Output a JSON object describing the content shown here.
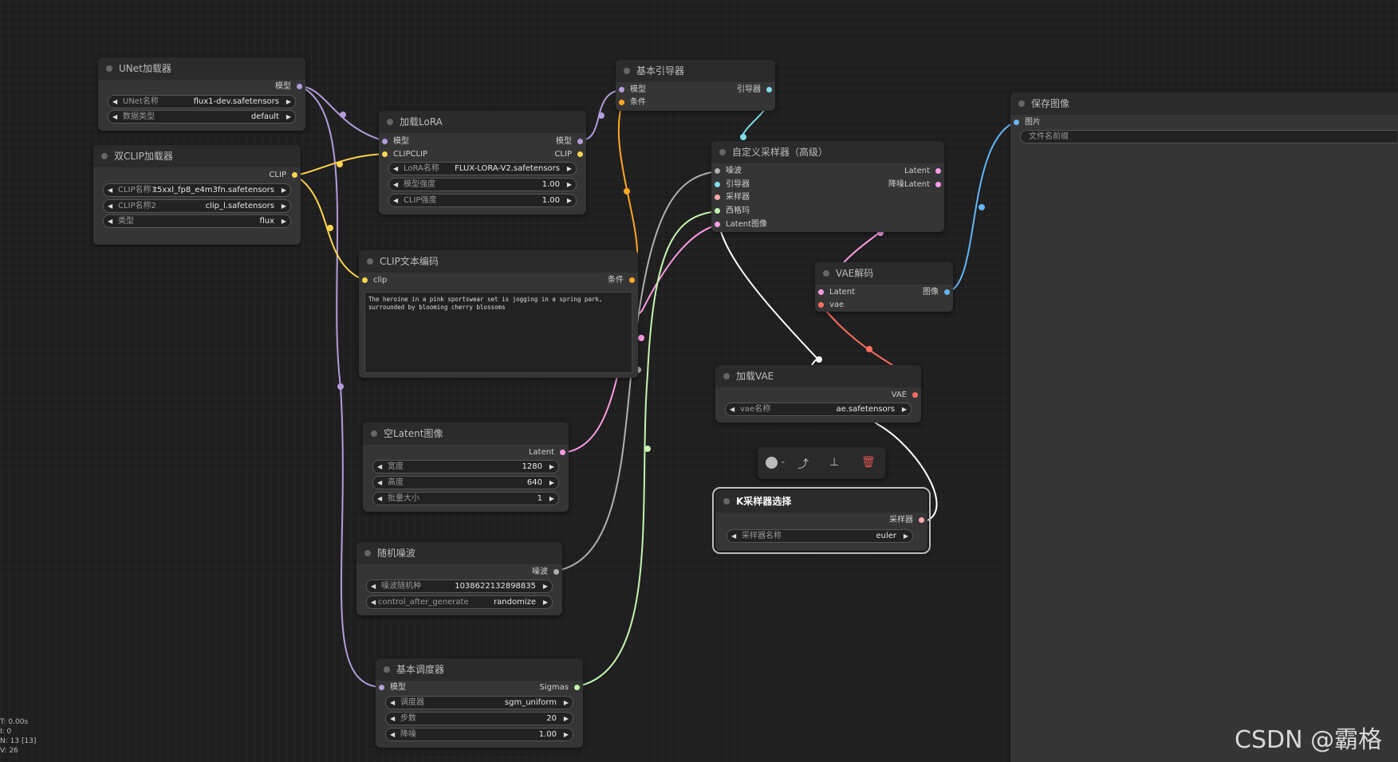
{
  "nodes": {
    "unet": {
      "title": "UNet加载器",
      "out_model": "模型",
      "w1": {
        "label": "UNet名称",
        "value": "flux1-dev.safetensors"
      },
      "w2": {
        "label": "数据类型",
        "value": "default"
      }
    },
    "dualclip": {
      "title": "双CLIP加载器",
      "out_clip": "CLIP",
      "w1": {
        "label": "CLIP名称1",
        "value": "t5xxl_fp8_e4m3fn.safetensors"
      },
      "w2": {
        "label": "CLIP名称2",
        "value": "clip_l.safetensors"
      },
      "w3": {
        "label": "类型",
        "value": "flux"
      }
    },
    "lora": {
      "title": "加载LoRA",
      "in_model": "模型",
      "in_clip": "CLIPCLIP",
      "out_model": "模型",
      "out_clip": "CLIP",
      "w1": {
        "label": "LoRA名称",
        "value": "FLUX-LORA-V2.safetensors"
      },
      "w2": {
        "label": "模型强度",
        "value": "1.00"
      },
      "w3": {
        "label": "CLIP强度",
        "value": "1.00"
      }
    },
    "guider": {
      "title": "基本引导器",
      "in_model": "模型",
      "in_cond": "条件",
      "out_guider": "引导器"
    },
    "clipenc": {
      "title": "CLIP文本编码",
      "in_clip": "clip",
      "out_cond": "条件",
      "text": "The heroine in a pink sportswear set is jogging in a spring park, surrounded by blooming cherry blossoms"
    },
    "sampler": {
      "title": "自定义采样器（高级）",
      "in_noise": "噪波",
      "in_guider": "引导器",
      "in_sampler": "采样器",
      "in_sigmas": "西格玛",
      "in_latent": "Latent图像",
      "out_latent": "Latent",
      "out_denoised": "降噪Latent"
    },
    "vaedec": {
      "title": "VAE解码",
      "in_latent": "Latent",
      "in_vae": "vae",
      "out_image": "图像"
    },
    "save": {
      "title": "保存图像",
      "in_image": "图片",
      "prefix": "文件名前缀"
    },
    "vaeload": {
      "title": "加载VAE",
      "out_vae": "VAE",
      "w1": {
        "label": "vae名称",
        "value": "ae.safetensors"
      }
    },
    "ksel": {
      "title": "K采样器选择",
      "out_sampler": "采样器",
      "w1": {
        "label": "采样器名称",
        "value": "euler"
      }
    },
    "latent": {
      "title": "空Latent图像",
      "out_latent": "Latent",
      "w1": {
        "label": "宽度",
        "value": "1280"
      },
      "w2": {
        "label": "高度",
        "value": "640"
      },
      "w3": {
        "label": "批量大小",
        "value": "1"
      }
    },
    "noise": {
      "title": "随机噪波",
      "out_noise": "噪波",
      "w1": {
        "label": "噪波随机种",
        "value": "1038622132898835"
      },
      "w2": {
        "label": "control_after_generate",
        "value": "randomize"
      }
    },
    "sched": {
      "title": "基本调度器",
      "in_model": "模型",
      "out_sigmas": "Sigmas",
      "w1": {
        "label": "调度器",
        "value": "sgm_uniform"
      },
      "w2": {
        "label": "步数",
        "value": "20"
      },
      "w3": {
        "label": "降噪",
        "value": "1.00"
      }
    }
  },
  "stats": [
    "T: 0.00s",
    "I: 0",
    "N: 13 [13]",
    "V: 26"
  ],
  "watermark": "CSDN @霸格",
  "colors": {
    "model": "#b39ddb",
    "clip": "#ffd54f",
    "cond": "#ffa726",
    "guider": "#80deea",
    "latent": "#ff9ce6",
    "sigmas": "#c5f5b0",
    "noise": "#b0b0b0",
    "sampler_link": "#ffffff",
    "vae": "#ff6e60",
    "image": "#64b5f6"
  },
  "toolbar_icons": [
    "color-dot-icon",
    "chevron-down-icon",
    "bypass-icon",
    "pin-icon",
    "trash-icon"
  ]
}
